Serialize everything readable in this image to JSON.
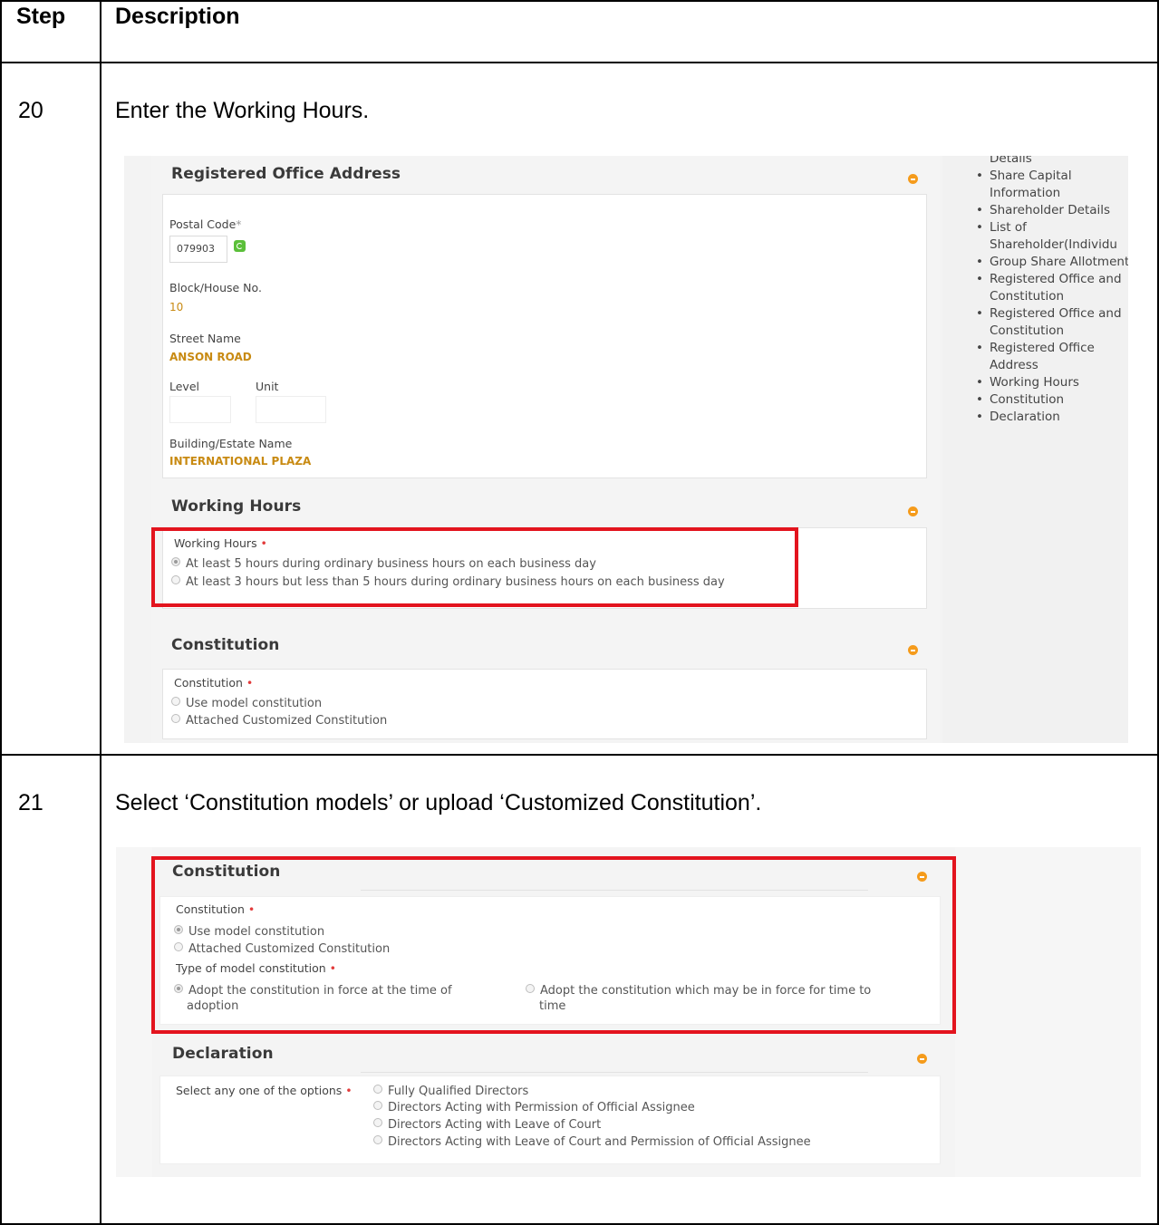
{
  "table": {
    "header_step": "Step",
    "header_description": "Description",
    "rows": [
      {
        "step": "20",
        "description": "Enter the Working Hours."
      },
      {
        "step": "21",
        "description": "Select ‘Constitution models’ or upload ‘Customized Constitution’."
      }
    ]
  },
  "shot1": {
    "sidebar_items": [
      "Details",
      "Share Capital Information",
      "Shareholder Details",
      "List of Shareholder(Individu",
      "Group Share Allotment",
      "Registered Office and Constitution",
      "Registered Office and Constitution",
      "Registered Office Address",
      "Working Hours",
      "Constitution",
      "Declaration"
    ],
    "registered_office": {
      "title": "Registered Office Address",
      "postal_code_label": "Postal Code",
      "postal_code_value": "079903",
      "block_label": "Block/House No.",
      "block_value": "10",
      "street_label": "Street Name",
      "street_value": "ANSON ROAD",
      "level_label": "Level",
      "unit_label": "Unit",
      "building_label": "Building/Estate Name",
      "building_value": "INTERNATIONAL PLAZA"
    },
    "working_hours": {
      "title": "Working Hours",
      "field_label": "Working Hours",
      "options": [
        "At least 5 hours during ordinary business hours on each business day",
        "At least 3 hours but less than 5 hours during ordinary business hours on each business day"
      ],
      "selected_index": 0
    },
    "constitution": {
      "title": "Constitution",
      "field_label": "Constitution",
      "options": [
        "Use model constitution",
        "Attached Customized Constitution"
      ]
    }
  },
  "shot2": {
    "constitution": {
      "title": "Constitution",
      "field_label": "Constitution",
      "options": [
        "Use model constitution",
        "Attached Customized Constitution"
      ],
      "selected_index": 0,
      "type_label": "Type of model constitution",
      "type_option_1a": "Adopt the constitution in force at the time of",
      "type_option_1b": "adoption",
      "type_option_2a": "Adopt the constitution which may be in force for time to",
      "type_option_2b": "time"
    },
    "declaration": {
      "title": "Declaration",
      "field_label": "Select any one of the options",
      "options": [
        "Fully Qualified Directors",
        "Directors Acting with Permission of Official Assignee",
        "Directors Acting with Leave of Court",
        "Directors Acting with Leave of Court and Permission of Official Assignee"
      ]
    }
  },
  "colors": {
    "highlight": "#e3141e",
    "accent": "#f59b1b",
    "value": "#c88a12",
    "required": "#e23b3b"
  }
}
